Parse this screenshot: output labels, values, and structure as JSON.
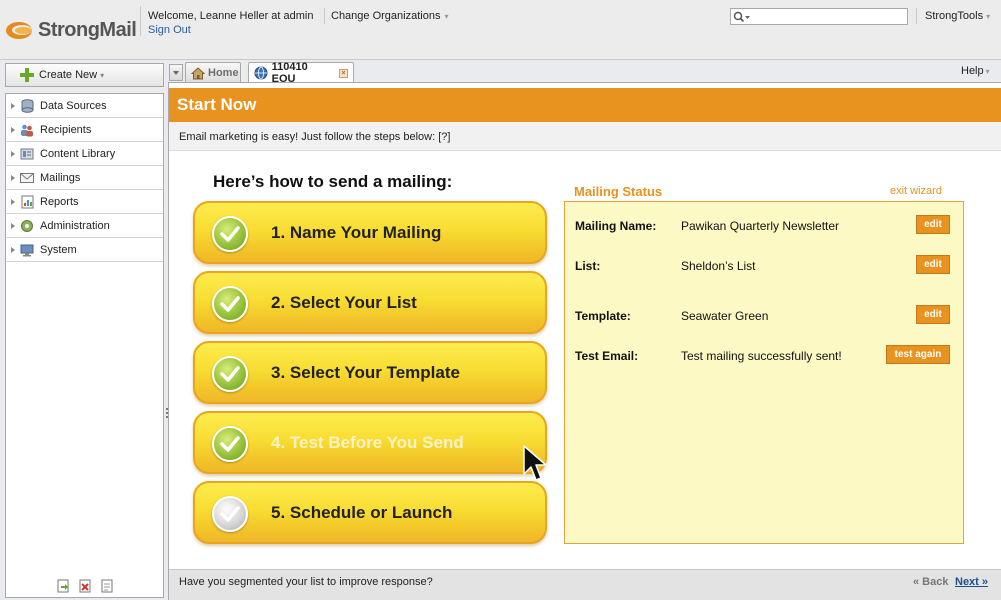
{
  "header": {
    "logo_text": "StrongMail",
    "welcome": "Welcome, Leanne Heller at admin",
    "signout": "Sign Out",
    "change_org": "Change Organizations",
    "search_value": "",
    "strongtools": "StrongTools"
  },
  "sidebar": {
    "create_new": "Create New",
    "items": [
      {
        "label": "Data Sources",
        "icon": "database-icon"
      },
      {
        "label": "Recipients",
        "icon": "people-icon"
      },
      {
        "label": "Content Library",
        "icon": "library-icon"
      },
      {
        "label": "Mailings",
        "icon": "envelope-icon"
      },
      {
        "label": "Reports",
        "icon": "report-icon"
      },
      {
        "label": "Administration",
        "icon": "admin-gear-icon"
      },
      {
        "label": "System",
        "icon": "system-icon"
      }
    ],
    "footer_icons": [
      "export-icon",
      "delete-icon",
      "document-icon"
    ]
  },
  "tabs": {
    "home": "Home",
    "active": "110410 EOU",
    "help": "Help"
  },
  "main": {
    "title": "Start Now",
    "intro": "Email marketing is easy! Just follow the steps below: [?]",
    "heading": "Here’s how to send a mailing:",
    "steps": [
      {
        "label": "1. Name Your Mailing",
        "done": true
      },
      {
        "label": "2. Select Your List",
        "done": true
      },
      {
        "label": "3. Select Your Template",
        "done": true
      },
      {
        "label": "4. Test Before You Send",
        "done": true
      },
      {
        "label": "5. Schedule or Launch",
        "done": false
      }
    ]
  },
  "status": {
    "title": "Mailing Status",
    "exit": "exit wizard",
    "rows": [
      {
        "key": "Mailing Name:",
        "value": "Pawikan Quarterly Newsletter",
        "button": "edit"
      },
      {
        "key": "List:",
        "value": "Sheldon’s List",
        "button": "edit"
      },
      {
        "key": "Template:",
        "value": "Seawater Green",
        "button": "edit"
      },
      {
        "key": "Test Email:",
        "value": "Test mailing successfully sent!",
        "button": "test again"
      }
    ]
  },
  "footer": {
    "tip": "Have you segmented your list to improve response?",
    "back": "« Back",
    "next": "Next »"
  },
  "colors": {
    "accent": "#e8921f",
    "step_fill": "#f8dd33",
    "status_bg": "#fdf9c5",
    "check_green": "#97c23c"
  }
}
